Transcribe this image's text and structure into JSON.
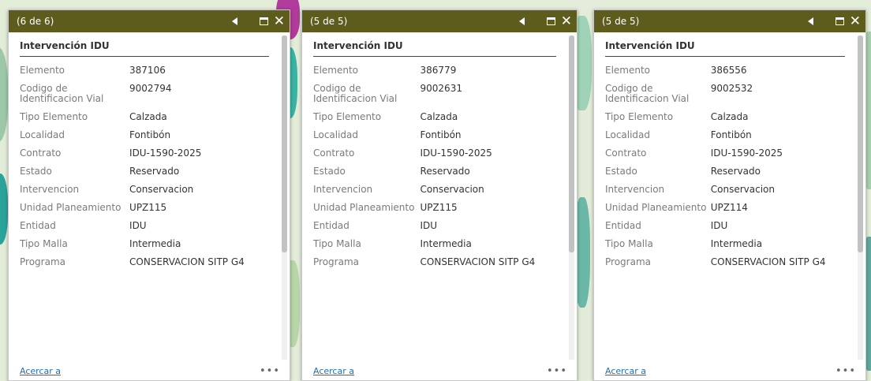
{
  "colors": {
    "titlebar": "#5e5c1d",
    "link": "#1e6fb5"
  },
  "popups": [
    {
      "pager": "(6 de 6)",
      "section_title": "Intervención IDU",
      "rows": [
        {
          "key": "Elemento",
          "value": "387106"
        },
        {
          "key": "Codigo de Identificacion Vial",
          "value": "9002794"
        },
        {
          "key": "Tipo Elemento",
          "value": "Calzada"
        },
        {
          "key": "Localidad",
          "value": "Fontibón"
        },
        {
          "key": "Contrato",
          "value": "IDU-1590-2025"
        },
        {
          "key": "Estado",
          "value": "Reservado"
        },
        {
          "key": "Intervencion",
          "value": "Conservacion"
        },
        {
          "key": "Unidad Planeamiento",
          "value": "UPZ115"
        },
        {
          "key": "Entidad",
          "value": "IDU"
        },
        {
          "key": "Tipo Malla",
          "value": "Intermedia"
        },
        {
          "key": "Programa",
          "value": "CONSERVACION SITP G4"
        }
      ],
      "zoom_label": "Acercar a",
      "more_label": "•••"
    },
    {
      "pager": "(5 de 5)",
      "section_title": "Intervención IDU",
      "rows": [
        {
          "key": "Elemento",
          "value": "386779"
        },
        {
          "key": "Codigo de Identificacion Vial",
          "value": "9002631"
        },
        {
          "key": "Tipo Elemento",
          "value": "Calzada"
        },
        {
          "key": "Localidad",
          "value": "Fontibón"
        },
        {
          "key": "Contrato",
          "value": "IDU-1590-2025"
        },
        {
          "key": "Estado",
          "value": "Reservado"
        },
        {
          "key": "Intervencion",
          "value": "Conservacion"
        },
        {
          "key": "Unidad Planeamiento",
          "value": "UPZ115"
        },
        {
          "key": "Entidad",
          "value": "IDU"
        },
        {
          "key": "Tipo Malla",
          "value": "Intermedia"
        },
        {
          "key": "Programa",
          "value": "CONSERVACION SITP G4"
        }
      ],
      "zoom_label": "Acercar a",
      "more_label": "•••"
    },
    {
      "pager": "(5 de 5)",
      "section_title": "Intervención IDU",
      "rows": [
        {
          "key": "Elemento",
          "value": "386556"
        },
        {
          "key": "Codigo de Identificacion Vial",
          "value": "9002532"
        },
        {
          "key": "Tipo Elemento",
          "value": "Calzada"
        },
        {
          "key": "Localidad",
          "value": "Fontibón"
        },
        {
          "key": "Contrato",
          "value": "IDU-1590-2025"
        },
        {
          "key": "Estado",
          "value": "Reservado"
        },
        {
          "key": "Intervencion",
          "value": "Conservacion"
        },
        {
          "key": "Unidad Planeamiento",
          "value": "UPZ114"
        },
        {
          "key": "Entidad",
          "value": "IDU"
        },
        {
          "key": "Tipo Malla",
          "value": "Intermedia"
        },
        {
          "key": "Programa",
          "value": "CONSERVACION SITP G4"
        }
      ],
      "zoom_label": "Acercar a",
      "more_label": "•••"
    }
  ]
}
